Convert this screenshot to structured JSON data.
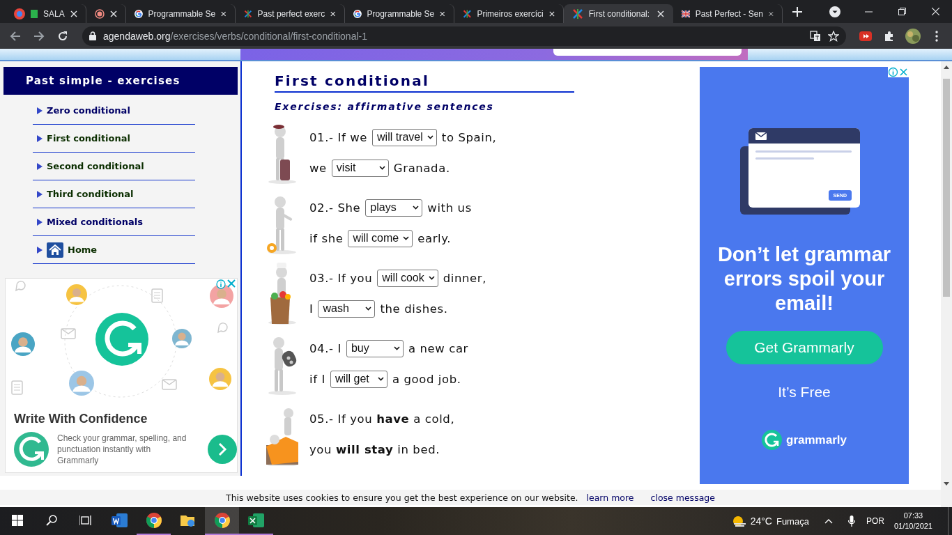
{
  "browser": {
    "tabs": [
      {
        "kind": "sala",
        "title": "SALA",
        "selected": false
      },
      {
        "kind": "recording",
        "selected": false
      },
      {
        "kind": "google",
        "title": "Programmable Se",
        "selected": false
      },
      {
        "kind": "agenda",
        "title": "Past perfect exerc",
        "selected": false
      },
      {
        "kind": "google",
        "title": "Programmable Se",
        "selected": false
      },
      {
        "kind": "agenda",
        "title": "Primeiros exercíci",
        "selected": false
      },
      {
        "kind": "agenda",
        "title": "First conditional:",
        "selected": true
      },
      {
        "kind": "flag",
        "title": "Past Perfect - Sen",
        "selected": false
      }
    ],
    "url_domain": "agendaweb.org",
    "url_path": "/exercises/verbs/conditional/first-conditional-1"
  },
  "sidebar": {
    "title": "Past simple - exercises",
    "items": [
      {
        "kind": "link",
        "label": "Zero conditional",
        "visited": false
      },
      {
        "kind": "link",
        "label": "First conditional",
        "visited": true
      },
      {
        "kind": "link",
        "label": "Second conditional",
        "visited": true
      },
      {
        "kind": "link",
        "label": "Third conditional",
        "visited": true
      },
      {
        "kind": "link",
        "label": "Mixed conditionals",
        "visited": false
      },
      {
        "kind": "home",
        "label": "Home",
        "visited": true
      }
    ]
  },
  "left_ad": {
    "headline": "Write With Confidence",
    "body": "Check your grammar, spelling, and punctuation instantly with Grammarly"
  },
  "main": {
    "title": "First conditional",
    "subtitle": "Exercises: affirmative sentences",
    "exercises": [
      {
        "lines": [
          [
            {
              "kind": "text",
              "text": "01.- If we"
            },
            {
              "kind": "select",
              "value": "will travel"
            },
            {
              "kind": "text",
              "text": "to Spain,"
            }
          ],
          [
            {
              "kind": "text",
              "text": "we"
            },
            {
              "kind": "select",
              "value": "visit"
            },
            {
              "kind": "text",
              "text": "Granada."
            }
          ]
        ]
      },
      {
        "lines": [
          [
            {
              "kind": "text",
              "text": "02.- She"
            },
            {
              "kind": "select",
              "value": "plays"
            },
            {
              "kind": "text",
              "text": "with us"
            }
          ],
          [
            {
              "kind": "text",
              "text": "if she"
            },
            {
              "kind": "select",
              "value": "will come"
            },
            {
              "kind": "text",
              "text": "early."
            }
          ]
        ]
      },
      {
        "lines": [
          [
            {
              "kind": "text",
              "text": "03.- If you"
            },
            {
              "kind": "select",
              "value": "will cook"
            },
            {
              "kind": "text",
              "text": "dinner,"
            }
          ],
          [
            {
              "kind": "text",
              "text": "I"
            },
            {
              "kind": "select",
              "value": "wash"
            },
            {
              "kind": "text",
              "text": "the dishes."
            }
          ]
        ]
      },
      {
        "lines": [
          [
            {
              "kind": "text",
              "text": "04.- I"
            },
            {
              "kind": "select",
              "value": "buy"
            },
            {
              "kind": "text",
              "text": "a new car"
            }
          ],
          [
            {
              "kind": "text",
              "text": "if I"
            },
            {
              "kind": "select",
              "value": "will get"
            },
            {
              "kind": "text",
              "text": "a good job."
            }
          ]
        ]
      },
      {
        "lines": [
          [
            {
              "kind": "text",
              "text": "05.- If you **have** a cold,"
            }
          ],
          [
            {
              "kind": "text",
              "text": "you **will stay** in bed."
            }
          ]
        ]
      }
    ]
  },
  "right_ad": {
    "send": "SEND",
    "headline": "Don’t let grammar errors spoil your email!",
    "button": "Get Grammarly",
    "note": "It’s Free",
    "brand": "grammarly"
  },
  "cookie_bar": {
    "message": "This website uses cookies to ensure you get the best experience on our website.",
    "learn_more": "learn more",
    "close": "close message"
  },
  "taskbar": {
    "apps": [
      {
        "kind": "windows",
        "running": false,
        "selected": false
      },
      {
        "kind": "search",
        "running": false,
        "selected": false
      },
      {
        "kind": "taskview",
        "running": false,
        "selected": false
      },
      {
        "kind": "word",
        "running": false,
        "selected": false
      },
      {
        "kind": "chrome",
        "running": true,
        "selected": false
      },
      {
        "kind": "files",
        "running": false,
        "selected": false
      },
      {
        "kind": "chrome",
        "running": true,
        "selected": true
      },
      {
        "kind": "excel",
        "running": true,
        "selected": false
      }
    ],
    "temperature": "24°C",
    "condition": "Fumaça",
    "language": "POR",
    "time": "07:33",
    "date": "01/10/2021"
  }
}
